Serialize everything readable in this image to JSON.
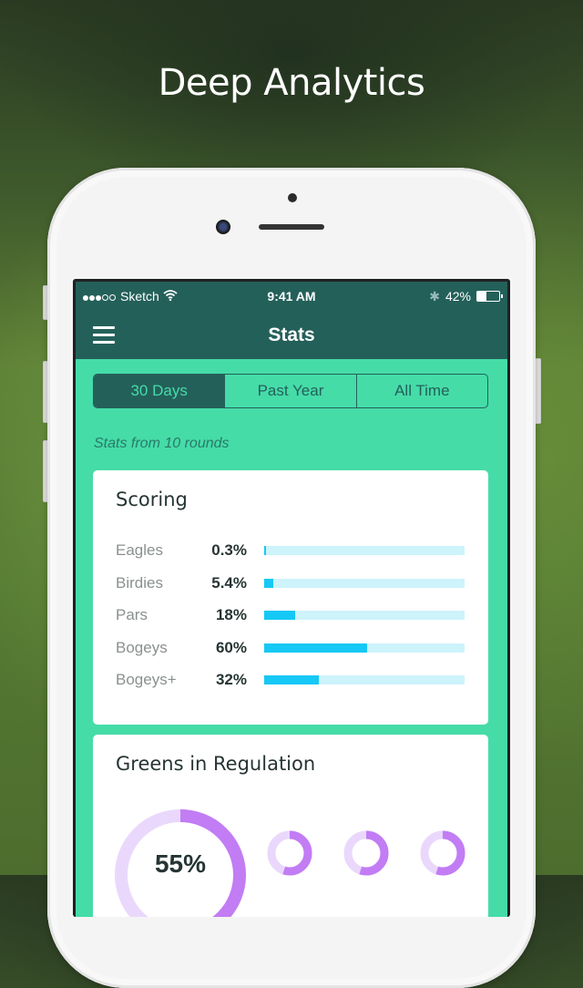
{
  "headline": "Deep Analytics",
  "status_bar": {
    "carrier": "Sketch",
    "signal_bars_filled": 3,
    "signal_bars_total": 5,
    "time": "9:41 AM",
    "battery_percent_text": "42%",
    "battery_level": 0.42
  },
  "nav": {
    "title": "Stats",
    "menu_icon": "hamburger-menu-icon"
  },
  "segments": [
    {
      "label": "30 Days",
      "active": true
    },
    {
      "label": "Past Year",
      "active": false
    },
    {
      "label": "All Time",
      "active": false
    }
  ],
  "subtitle": "Stats from 10 rounds",
  "scoring": {
    "title": "Scoring",
    "rows": [
      {
        "label": "Eagles",
        "value": "0.3%",
        "fraction": 0.003
      },
      {
        "label": "Birdies",
        "value": "5.4%",
        "fraction": 0.054
      },
      {
        "label": "Pars",
        "value": "18%",
        "fraction": 0.18
      },
      {
        "label": "Bogeys",
        "value": "60%",
        "fraction": 0.6
      },
      {
        "label": "Bogeys+",
        "value": "32%",
        "fraction": 0.32
      }
    ]
  },
  "gir": {
    "title": "Greens in Regulation",
    "overall_label": "55%",
    "overall_fraction": 0.55,
    "small_donuts": [
      0.55,
      0.55,
      0.55
    ]
  },
  "colors": {
    "nav_bg": "#24605a",
    "screen_bg": "#45dca8",
    "bar_fill": "#16c8f5",
    "bar_track": "#cdf3fb",
    "donut_fill": "#c27cf4",
    "donut_track": "#ead8fc"
  }
}
